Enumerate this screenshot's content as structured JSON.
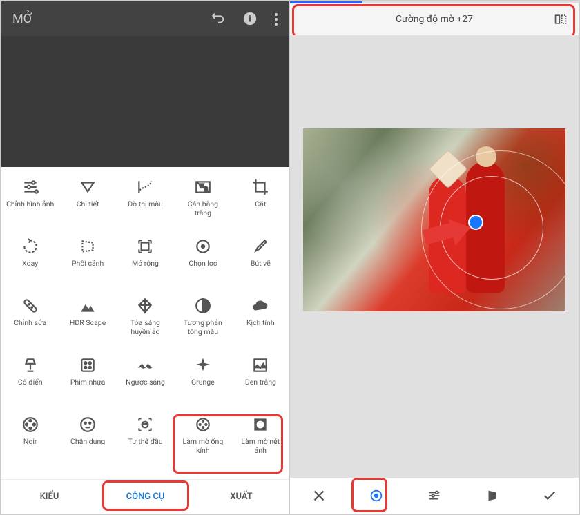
{
  "left": {
    "title": "MỞ",
    "tools": [
      {
        "label": "Chỉnh hình ảnh",
        "icon": "tune"
      },
      {
        "label": "Chi tiết",
        "icon": "triangle-down"
      },
      {
        "label": "Đồ thị màu",
        "icon": "curve"
      },
      {
        "label": "Cân bằng trắng",
        "icon": "wb"
      },
      {
        "label": "Cắt",
        "icon": "crop"
      },
      {
        "label": "Xoay",
        "icon": "rotate"
      },
      {
        "label": "Phối cảnh",
        "icon": "perspective"
      },
      {
        "label": "Mở rộng",
        "icon": "expand"
      },
      {
        "label": "Chọn lọc",
        "icon": "target"
      },
      {
        "label": "Bút vẽ",
        "icon": "brush"
      },
      {
        "label": "Chỉnh sửa",
        "icon": "bandage"
      },
      {
        "label": "HDR Scape",
        "icon": "mountains"
      },
      {
        "label": "Tỏa sáng huyền ảo",
        "icon": "diamond"
      },
      {
        "label": "Tương phản tông màu",
        "icon": "contrast"
      },
      {
        "label": "Kịch tính",
        "icon": "cloud"
      },
      {
        "label": "Cổ điển",
        "icon": "lamp"
      },
      {
        "label": "Phim nhựa",
        "icon": "dice"
      },
      {
        "label": "Ngược sáng",
        "icon": "mustache"
      },
      {
        "label": "Grunge",
        "icon": "sparkle"
      },
      {
        "label": "Đen trắng",
        "icon": "image"
      },
      {
        "label": "Noir",
        "icon": "reel"
      },
      {
        "label": "Chân dung",
        "icon": "face"
      },
      {
        "label": "Tư thế đầu",
        "icon": "face-scan"
      },
      {
        "label": "Làm mờ ống kính",
        "icon": "lens-blur"
      },
      {
        "label": "Làm mờ nét ảnh",
        "icon": "vignette"
      }
    ],
    "tabs": {
      "style": "KIỂU",
      "tools": "CÔNG CỤ",
      "export": "XUẤT"
    }
  },
  "right": {
    "header": "Cường độ mờ +27",
    "progress": 25
  }
}
